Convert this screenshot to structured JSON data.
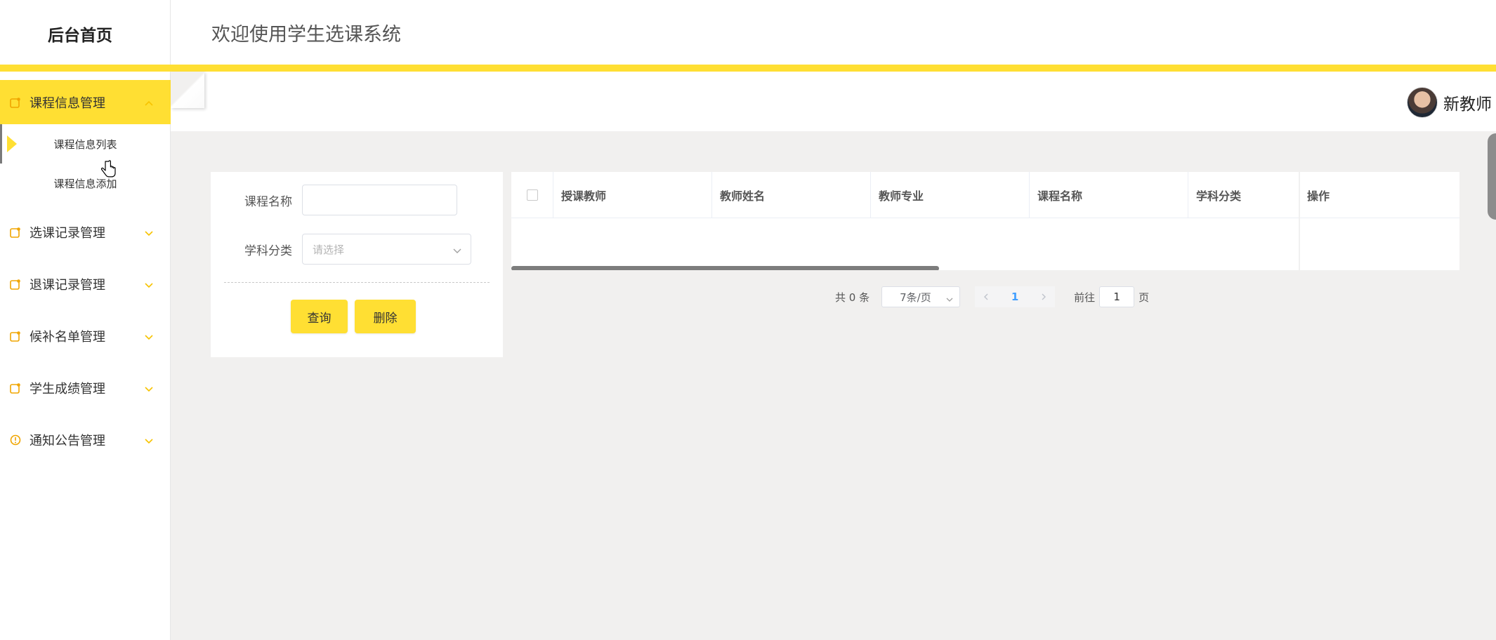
{
  "brand": {
    "title": "后台首页"
  },
  "header": {
    "title": "欢迎使用学生选课系统"
  },
  "user": {
    "name": "新教师"
  },
  "colors": {
    "accent": "#ffdf33",
    "active_page": "#409eff"
  },
  "sidebar": {
    "items": [
      {
        "label": "课程信息管理",
        "icon": "edit-icon",
        "expanded": true,
        "children": [
          {
            "label": "课程信息列表",
            "selected": true
          },
          {
            "label": "课程信息添加",
            "selected": false
          }
        ]
      },
      {
        "label": "选课记录管理",
        "icon": "edit-icon",
        "expanded": false
      },
      {
        "label": "退课记录管理",
        "icon": "edit-icon",
        "expanded": false
      },
      {
        "label": "候补名单管理",
        "icon": "edit-icon",
        "expanded": false
      },
      {
        "label": "学生成绩管理",
        "icon": "edit-icon",
        "expanded": false
      },
      {
        "label": "通知公告管理",
        "icon": "info-icon",
        "expanded": false
      }
    ]
  },
  "search": {
    "course_name_label": "课程名称",
    "course_name_value": "",
    "category_label": "学科分类",
    "category_placeholder": "请选择",
    "query_button": "查询",
    "delete_button": "删除"
  },
  "table": {
    "columns": [
      "授课教师",
      "教师姓名",
      "教师专业",
      "课程名称",
      "学科分类",
      "操作"
    ],
    "rows": []
  },
  "pagination": {
    "total_text": "共 0 条",
    "page_size": "7条/页",
    "current_page": "1",
    "goto_prefix": "前往",
    "goto_value": "1",
    "goto_suffix": "页"
  }
}
